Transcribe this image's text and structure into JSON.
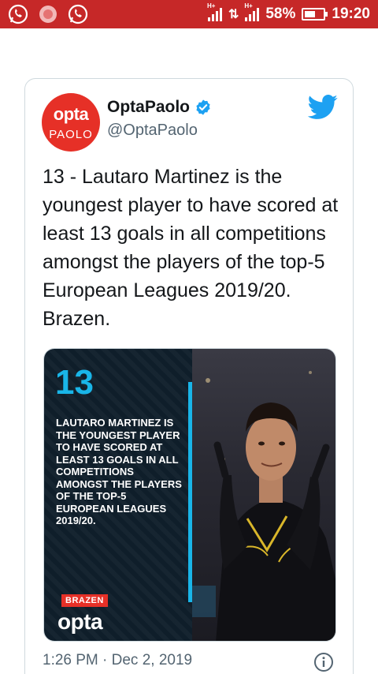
{
  "status_bar": {
    "battery_percent": "58%",
    "time": "19:20",
    "battery_level": 0.58,
    "left_icons": [
      "whatsapp-icon",
      "notification-dot-icon",
      "whatsapp-icon"
    ],
    "network_tags": [
      "H+",
      "H+"
    ],
    "background_color": "#c62828"
  },
  "tweet": {
    "avatar": {
      "line1": "opta",
      "line2": "PAOLO"
    },
    "display_name": "OptaPaolo",
    "handle": "@OptaPaolo",
    "verified": true,
    "text": "13 - Lautaro Martinez is the youngest player to have scored at least 13 goals in all competitions amongst the players of the top-5 European Leagues 2019/20. Brazen.",
    "media": {
      "big_number": "13",
      "stat_text": "LAUTARO MARTINEZ IS THE YOUNGEST PLAYER TO HAVE SCORED AT LEAST 13 GOALS IN ALL COMPETITIONS AMONGST THE PLAYERS OF THE TOP-5 EUROPEAN LEAGUES 2019/20.",
      "tag": "BRAZEN",
      "logo": "opta"
    },
    "timestamp": "1:26 PM · Dec 2, 2019"
  },
  "colors": {
    "accent_blue": "#19b5e8",
    "opta_red": "#e63027",
    "twitter_blue": "#1da1f2"
  }
}
